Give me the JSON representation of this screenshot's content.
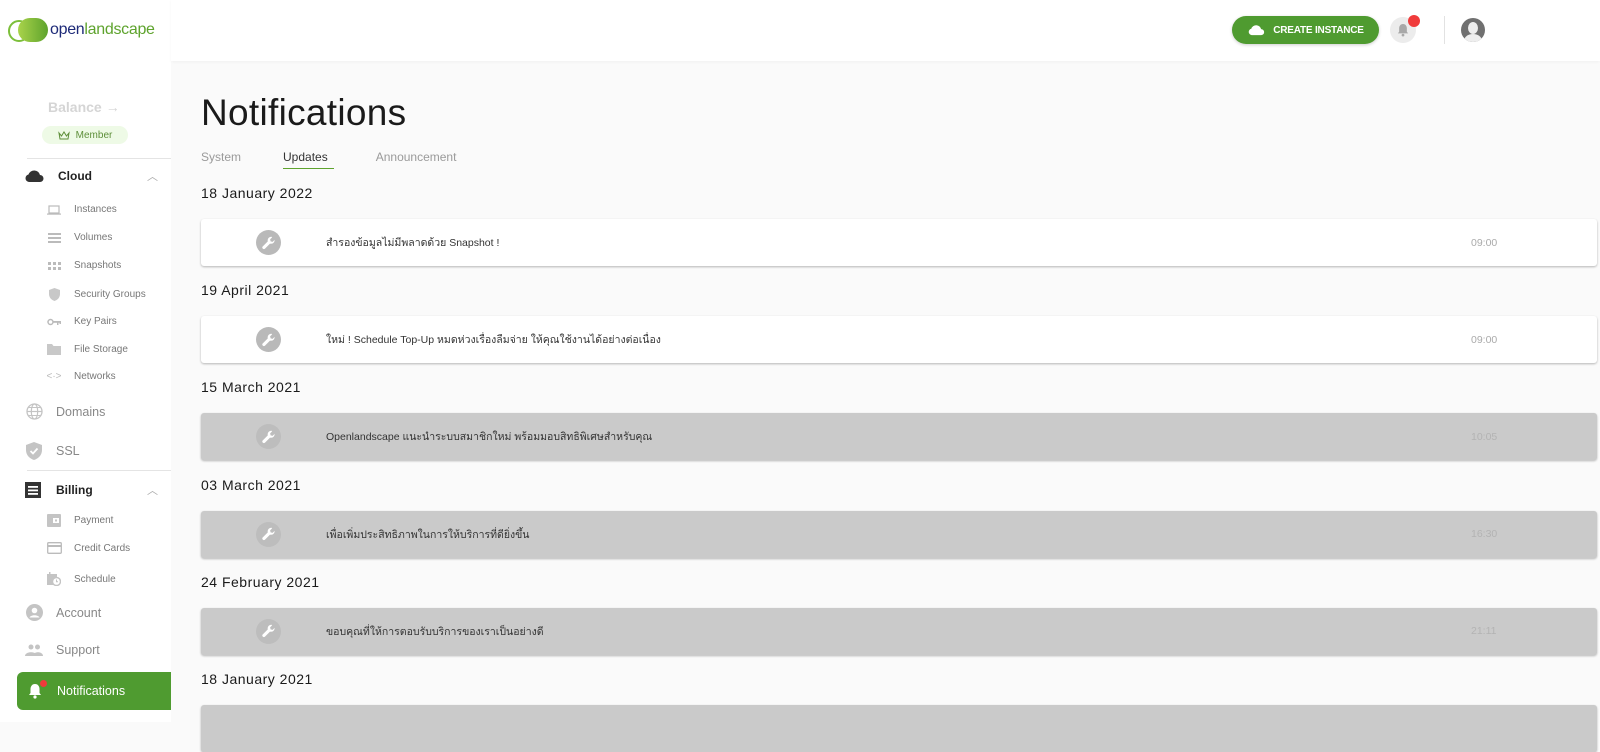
{
  "brand": {
    "name_part1": "open",
    "name_part2": "landscape"
  },
  "sidebar": {
    "balance_label": "Balance",
    "member_badge": "Member",
    "cloud": {
      "label": "Cloud",
      "items": [
        {
          "label": "Instances",
          "icon": "laptop-icon"
        },
        {
          "label": "Volumes",
          "icon": "volumes-icon"
        },
        {
          "label": "Snapshots",
          "icon": "snapshots-icon"
        },
        {
          "label": "Security Groups",
          "icon": "shield-icon"
        },
        {
          "label": "Key Pairs",
          "icon": "key-icon"
        },
        {
          "label": "File Storage",
          "icon": "folder-icon"
        },
        {
          "label": "Networks",
          "icon": "code-icon"
        }
      ]
    },
    "domains": "Domains",
    "ssl": "SSL",
    "billing": {
      "label": "Billing",
      "items": [
        {
          "label": "Payment",
          "icon": "wallet-icon"
        },
        {
          "label": "Credit Cards",
          "icon": "credit-card-icon"
        },
        {
          "label": "Schedule",
          "icon": "schedule-icon"
        }
      ]
    },
    "account": "Account",
    "support": "Support",
    "notifications": "Notifications"
  },
  "topbar": {
    "create_instance": "CREATE INSTANCE"
  },
  "page": {
    "title": "Notifications",
    "tabs": [
      "System",
      "Updates",
      "Announcement"
    ],
    "active_tab": "Updates",
    "groups": [
      {
        "date": "18 January 2022",
        "message": "สำรองข้อมูลไม่มีพลาดด้วย Snapshot !",
        "time": "09:00",
        "read": false
      },
      {
        "date": "19 April 2021",
        "message": "ใหม่ ! Schedule Top-Up หมดห่วงเรื่องลืมจ่าย ให้คุณใช้งานได้อย่างต่อเนื่อง",
        "time": "09:00",
        "read": false
      },
      {
        "date": "15 March 2021",
        "message": "Openlandscape แนะนำระบบสมาชิกใหม่ พร้อมมอบสิทธิพิเศษสำหรับคุณ",
        "time": "10:05",
        "read": true
      },
      {
        "date": "03 March 2021",
        "message": "เพื่อเพิ่มประสิทธิภาพในการให้บริการที่ดียิ่งขึ้น",
        "time": "16:30",
        "read": true
      },
      {
        "date": "24 February 2021",
        "message": "ขอบคุณที่ให้การตอบรับบริการของเราเป็นอย่างดี",
        "time": "21:11",
        "read": true
      },
      {
        "date": "18 January 2021"
      }
    ]
  }
}
